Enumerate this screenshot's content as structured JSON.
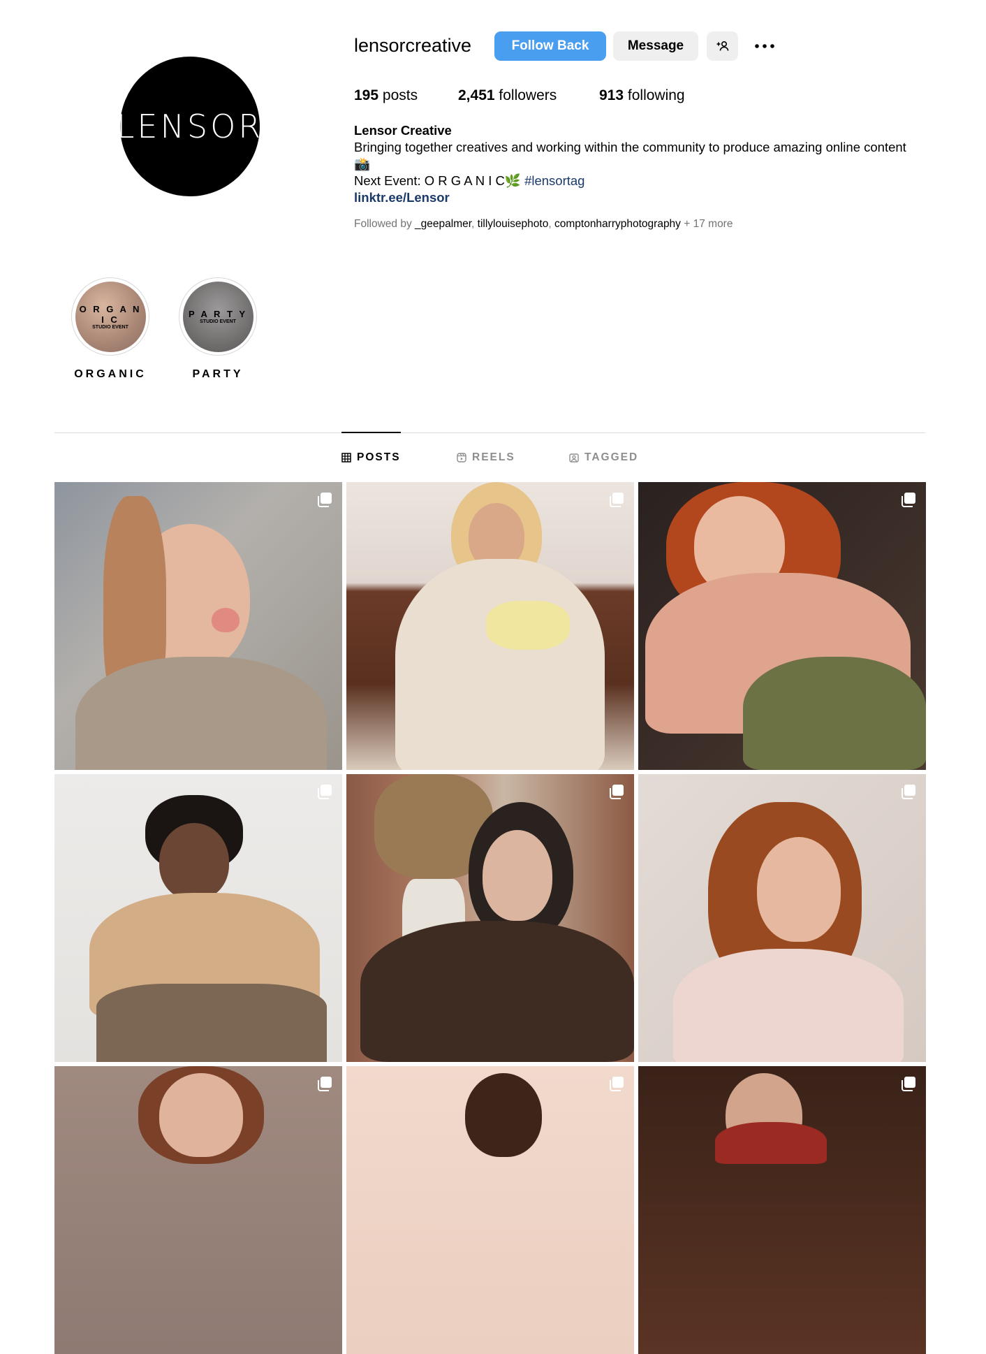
{
  "profile": {
    "avatar_text": "LENSOR",
    "username": "lensorcreative",
    "follow_button": "Follow Back",
    "message_button": "Message",
    "add_user_icon": "add-person-icon",
    "more_icon": "more-horizontal-icon",
    "stats": {
      "posts_count": "195",
      "posts_label": "posts",
      "followers_count": "2,451",
      "followers_label": "followers",
      "following_count": "913",
      "following_label": "following"
    },
    "bio": {
      "name": "Lensor Creative",
      "line1": "Bringing together creatives and working within the community to produce amazing online content 📸",
      "event_prefix": "Next Event: O R G A N I C🌿",
      "hashtag": "#lensortag",
      "link": "linktr.ee/Lensor"
    },
    "followed_by": {
      "prefix": "Followed by",
      "users": [
        "_geepalmer",
        "tillylouisephoto",
        "comptonharryphotography"
      ],
      "more": "+ 17 more"
    }
  },
  "highlights": [
    {
      "title": "O R G A N I C",
      "subtitle": "STUDIO EVENT",
      "label": "ORGANIC"
    },
    {
      "title": "P A R T Y",
      "subtitle": "STUDIO EVENT",
      "label": "PARTY"
    }
  ],
  "tabs": [
    {
      "label": "POSTS",
      "icon": "grid-icon",
      "active": true
    },
    {
      "label": "REELS",
      "icon": "reels-icon",
      "active": false
    },
    {
      "label": "TAGGED",
      "icon": "tagged-icon",
      "active": false
    }
  ],
  "colors": {
    "accent": "#4a9ef0",
    "link": "#1a3a6a",
    "muted": "#737373"
  }
}
